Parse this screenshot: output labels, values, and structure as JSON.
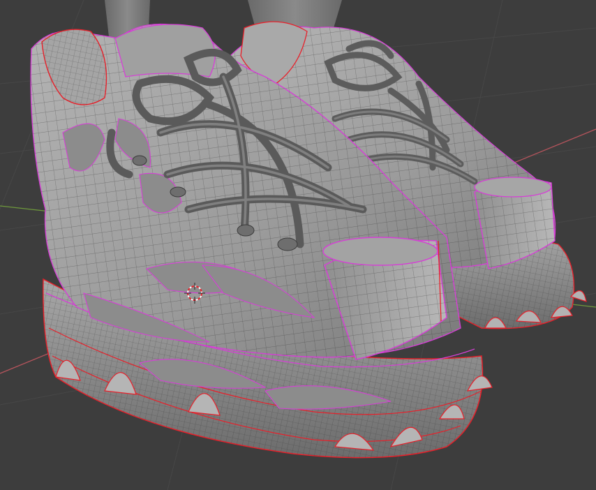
{
  "viewport": {
    "shading": "solid",
    "overlay": "wireframe",
    "background_color": "#3d3d3d",
    "grid_line_color": "#4a4a4a",
    "axis_x_color": "#b5545c",
    "axis_y_color": "#6f9a3c"
  },
  "scene": {
    "object": "pair-of-sneakers",
    "mesh_color": "#9a9a9a",
    "wire_color": "#2c2c2c",
    "seam_color": "#e8202a",
    "sharp_edge_color": "#d63fd6",
    "cursor": "3d-cursor"
  }
}
